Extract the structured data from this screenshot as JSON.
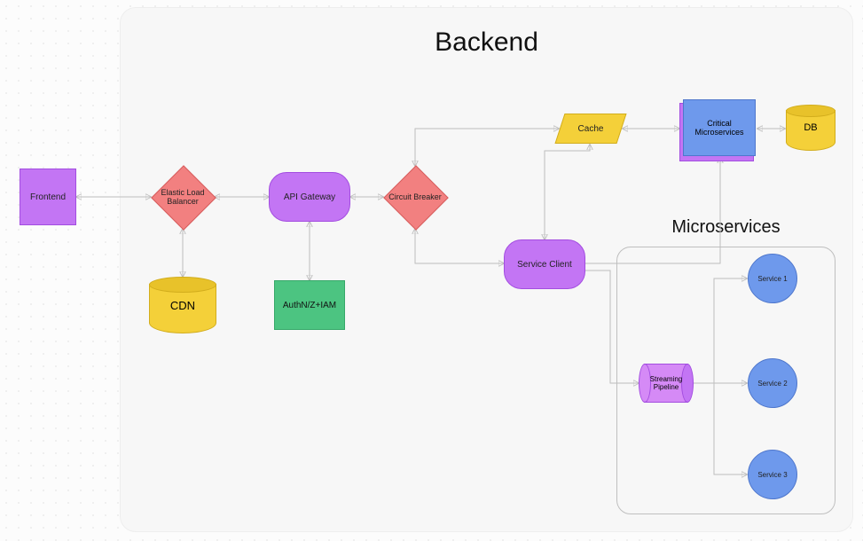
{
  "diagram": {
    "backend_title": "Backend",
    "microservices_title": "Microservices",
    "nodes": {
      "frontend": "Frontend",
      "elb": "Elastic Load Balancer",
      "api_gateway": "API Gateway",
      "circuit_breaker": "Circuit Breaker",
      "cdn": "CDN",
      "authnz": "AuthN/Z+IAM",
      "cache": "Cache",
      "service_client": "Service Client",
      "critical_ms": "Critical Microservices",
      "db": "DB",
      "streaming_pipeline": "Streaming Pipeline",
      "service1": "Service 1",
      "service2": "Service 2",
      "service3": "Service 3"
    }
  },
  "colors": {
    "purple": "#c375f4",
    "red": "#f28080",
    "green": "#4cc481",
    "yellow": "#f4d039",
    "blue": "#6e99ec",
    "arrow": "#bdbdbd"
  },
  "chart_data": {
    "type": "diagram",
    "title": "Backend",
    "containers": [
      {
        "id": "backend",
        "label": "Backend",
        "children": [
          "elb",
          "api_gateway",
          "circuit_breaker",
          "cdn",
          "authnz",
          "cache",
          "service_client",
          "critical_ms",
          "db",
          "microservices_group"
        ]
      },
      {
        "id": "microservices_group",
        "label": "Microservices",
        "children": [
          "streaming_pipeline",
          "service1",
          "service2",
          "service3"
        ]
      }
    ],
    "nodes": [
      {
        "id": "frontend",
        "label": "Frontend",
        "shape": "rect",
        "color": "purple"
      },
      {
        "id": "elb",
        "label": "Elastic Load Balancer",
        "shape": "diamond",
        "color": "red"
      },
      {
        "id": "api_gateway",
        "label": "API Gateway",
        "shape": "rounded-rect",
        "color": "purple"
      },
      {
        "id": "circuit_breaker",
        "label": "Circuit Breaker",
        "shape": "diamond",
        "color": "red"
      },
      {
        "id": "cdn",
        "label": "CDN",
        "shape": "cylinder",
        "color": "yellow"
      },
      {
        "id": "authnz",
        "label": "AuthN/Z+IAM",
        "shape": "rect",
        "color": "green"
      },
      {
        "id": "cache",
        "label": "Cache",
        "shape": "parallelogram",
        "color": "yellow"
      },
      {
        "id": "service_client",
        "label": "Service Client",
        "shape": "rounded-rect",
        "color": "purple"
      },
      {
        "id": "critical_ms",
        "label": "Critical Microservices",
        "shape": "stacked-rect",
        "color": "blue"
      },
      {
        "id": "db",
        "label": "DB",
        "shape": "cylinder",
        "color": "yellow"
      },
      {
        "id": "streaming_pipeline",
        "label": "Streaming Pipeline",
        "shape": "horizontal-cylinder",
        "color": "purple"
      },
      {
        "id": "service1",
        "label": "Service 1",
        "shape": "circle",
        "color": "blue"
      },
      {
        "id": "service2",
        "label": "Service 2",
        "shape": "circle",
        "color": "blue"
      },
      {
        "id": "service3",
        "label": "Service 3",
        "shape": "circle",
        "color": "blue"
      }
    ],
    "edges": [
      {
        "from": "frontend",
        "to": "elb",
        "dir": "both"
      },
      {
        "from": "elb",
        "to": "api_gateway",
        "dir": "both"
      },
      {
        "from": "api_gateway",
        "to": "circuit_breaker",
        "dir": "both"
      },
      {
        "from": "elb",
        "to": "cdn",
        "dir": "both"
      },
      {
        "from": "api_gateway",
        "to": "authnz",
        "dir": "both"
      },
      {
        "from": "circuit_breaker",
        "to": "cache",
        "dir": "both"
      },
      {
        "from": "circuit_breaker",
        "to": "service_client",
        "dir": "both"
      },
      {
        "from": "cache",
        "to": "service_client",
        "dir": "both"
      },
      {
        "from": "cache",
        "to": "critical_ms",
        "dir": "both"
      },
      {
        "from": "critical_ms",
        "to": "db",
        "dir": "both"
      },
      {
        "from": "service_client",
        "to": "critical_ms",
        "dir": "forward"
      },
      {
        "from": "service_client",
        "to": "streaming_pipeline",
        "dir": "forward"
      },
      {
        "from": "streaming_pipeline",
        "to": "service1",
        "dir": "forward"
      },
      {
        "from": "streaming_pipeline",
        "to": "service2",
        "dir": "forward"
      },
      {
        "from": "streaming_pipeline",
        "to": "service3",
        "dir": "forward"
      }
    ]
  }
}
